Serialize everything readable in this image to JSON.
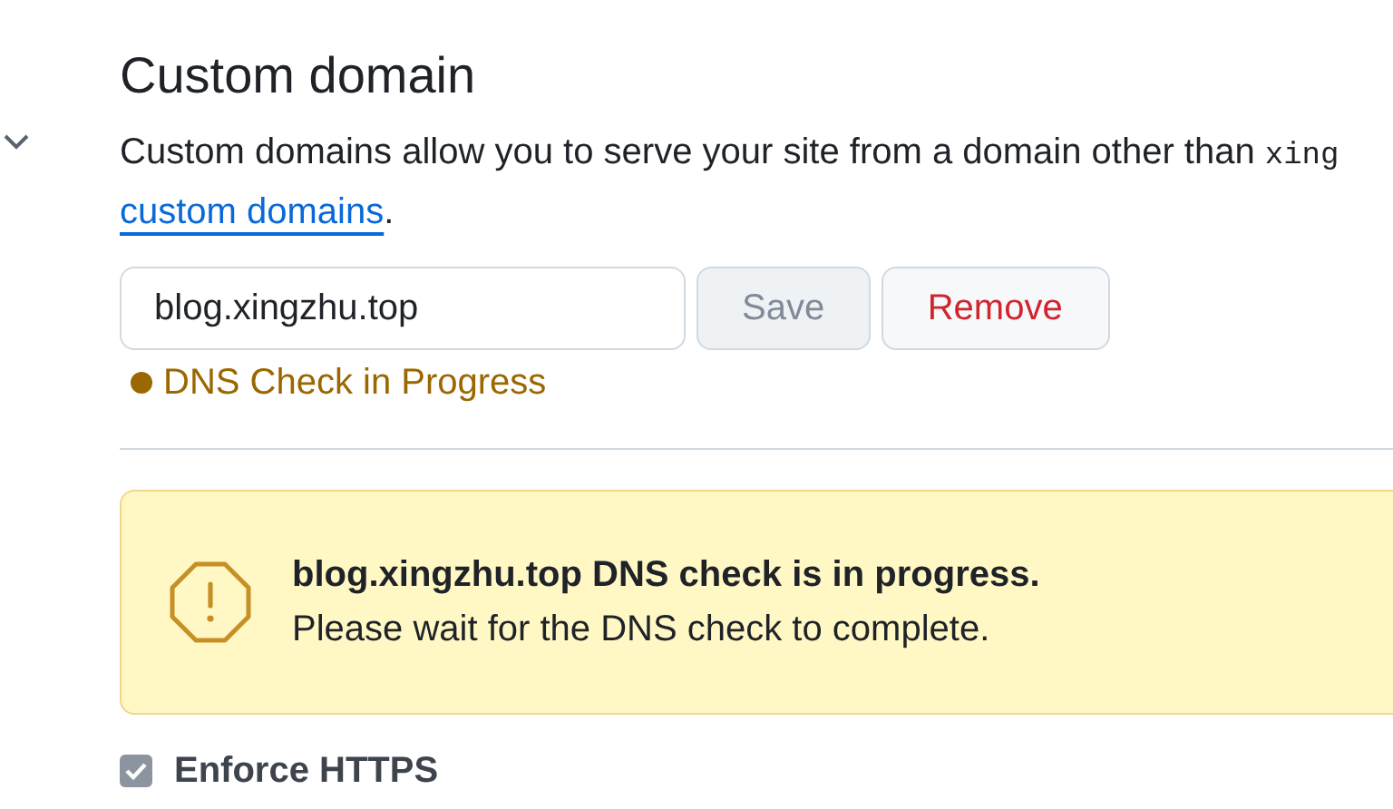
{
  "section": {
    "title": "Custom domain",
    "description": "Custom domains allow you to serve your site from a domain other than ",
    "code": "xing",
    "link": "custom domains",
    "description_end": "."
  },
  "domain_field": {
    "value": "blog.xingzhu.top"
  },
  "buttons": [
    {
      "label": "Save",
      "kind": "save",
      "disabled": true
    },
    {
      "label": "Remove",
      "kind": "danger",
      "disabled": false
    }
  ],
  "dns_status": {
    "label": "DNS Check in Progress"
  },
  "alert": {
    "title": "blog.xingzhu.top DNS check is in progress.",
    "message": "Please wait for the DNS check to complete."
  },
  "enforce_https": {
    "label": "Enforce HTTPS",
    "checked": true,
    "disabled": true
  }
}
